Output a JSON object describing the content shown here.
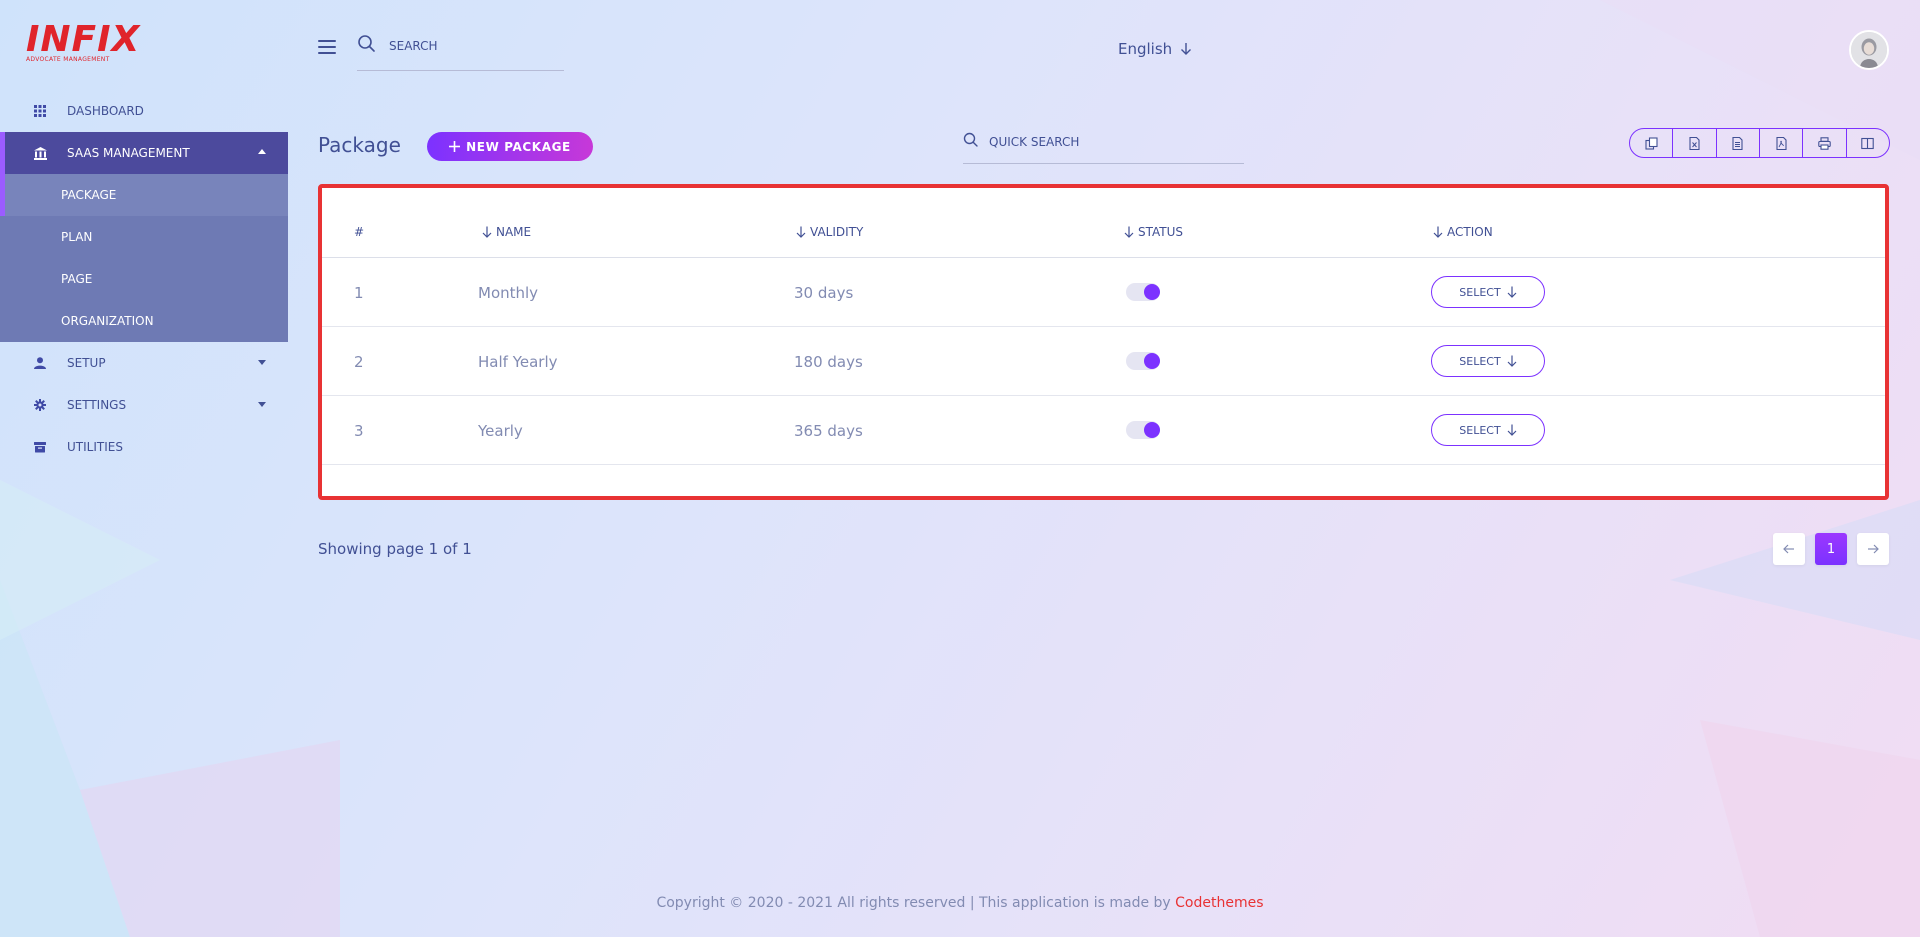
{
  "app": {
    "logo_text": "INFIX",
    "logo_subtitle": "ADVOCATE MANAGEMENT",
    "colors": {
      "accent": "#7c32ff",
      "accent_end": "#c738d8",
      "active_menu": "#4c4a9d",
      "submenu": "#6e7ab4",
      "highlight_border": "#e83234",
      "brand_link": "#e83234"
    }
  },
  "sidebar": {
    "items": [
      {
        "label": "DASHBOARD",
        "icon": "grid-icon"
      },
      {
        "label": "SAAS MANAGEMENT",
        "icon": "bank-icon",
        "expanded": true,
        "children": [
          {
            "label": "PACKAGE",
            "active": true
          },
          {
            "label": "PLAN"
          },
          {
            "label": "PAGE"
          },
          {
            "label": "ORGANIZATION"
          }
        ]
      },
      {
        "label": "SETUP",
        "icon": "user-icon",
        "has_caret": true
      },
      {
        "label": "SETTINGS",
        "icon": "gear-icon",
        "has_caret": true
      },
      {
        "label": "UTILITIES",
        "icon": "archive-icon"
      }
    ]
  },
  "header": {
    "search_placeholder": "SEARCH",
    "language": "English"
  },
  "page": {
    "title": "Package",
    "new_button_label": "NEW PACKAGE",
    "quick_search_placeholder": "QUICK SEARCH",
    "export_buttons": [
      "copy-icon",
      "excel-icon",
      "csv-icon",
      "pdf-icon",
      "print-icon",
      "columns-icon"
    ]
  },
  "table": {
    "columns": [
      "#",
      "NAME",
      "VALIDITY",
      "STATUS",
      "ACTION"
    ],
    "rows": [
      {
        "num": "1",
        "name": "Monthly",
        "validity": "30 days",
        "status": true,
        "action": "SELECT"
      },
      {
        "num": "2",
        "name": "Half Yearly",
        "validity": "180 days",
        "status": true,
        "action": "SELECT"
      },
      {
        "num": "3",
        "name": "Yearly",
        "validity": "365 days",
        "status": true,
        "action": "SELECT"
      }
    ]
  },
  "pagination": {
    "summary": "Showing page 1 of 1",
    "current_page": "1"
  },
  "footer": {
    "text": "Copyright © 2020 - 2021 All rights reserved | This application is made by ",
    "brand": "Codethemes"
  }
}
